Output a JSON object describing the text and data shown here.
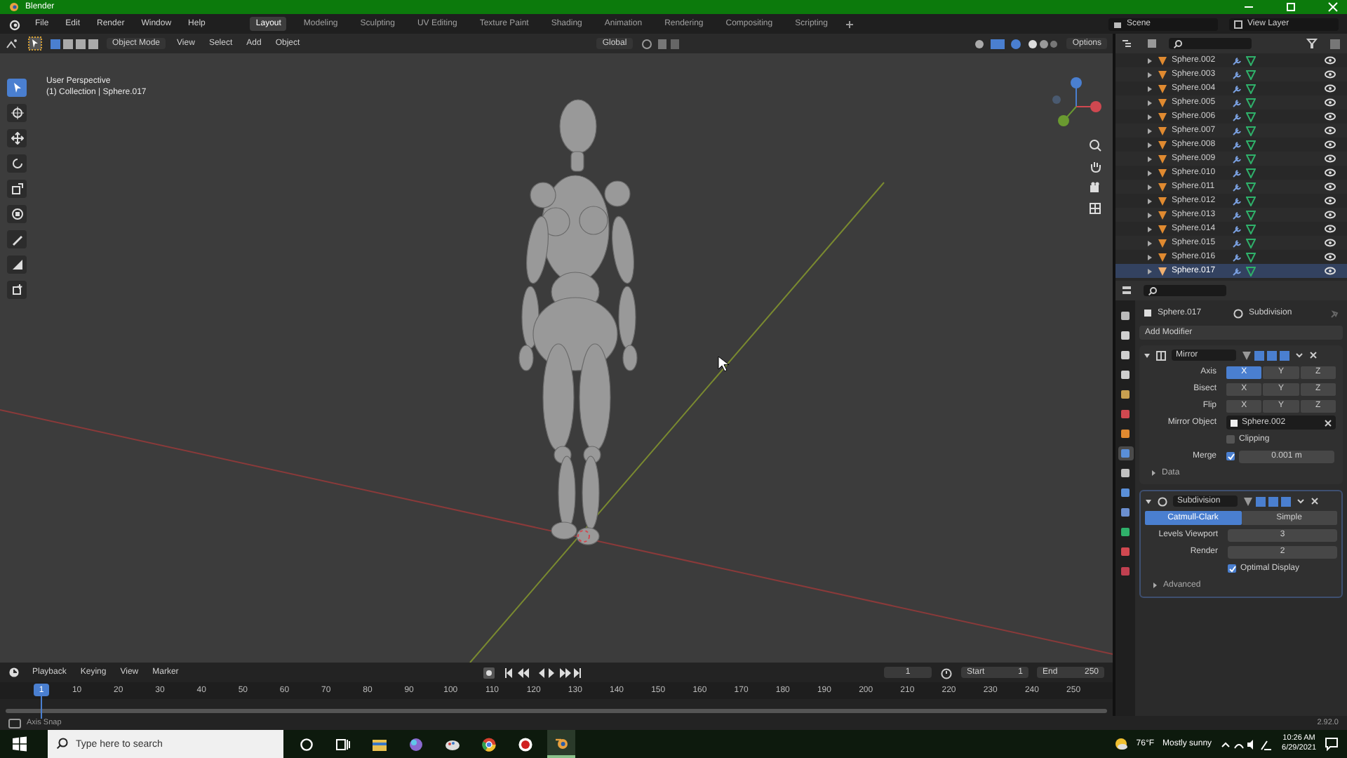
{
  "window": {
    "title": "Blender"
  },
  "menu": [
    "File",
    "Edit",
    "Render",
    "Window",
    "Help"
  ],
  "workspaces": [
    {
      "label": "Layout",
      "selected": true
    },
    {
      "label": "Modeling",
      "selected": false
    },
    {
      "label": "Sculpting",
      "selected": false
    },
    {
      "label": "UV Editing",
      "selected": false
    },
    {
      "label": "Texture Paint",
      "selected": false
    },
    {
      "label": "Shading",
      "selected": false
    },
    {
      "label": "Animation",
      "selected": false
    },
    {
      "label": "Rendering",
      "selected": false
    },
    {
      "label": "Compositing",
      "selected": false
    },
    {
      "label": "Scripting",
      "selected": false
    }
  ],
  "scene": "Scene",
  "view_layer": "View Layer",
  "viewport": {
    "mode": "Object Mode",
    "menus": [
      "View",
      "Select",
      "Add",
      "Object"
    ],
    "orientation": "Global",
    "options": "Options",
    "overlay_title": "User Perspective",
    "overlay_info": "(1) Collection | Sphere.017",
    "tools": [
      {
        "kind": "select",
        "selected": true
      },
      {
        "kind": "cursor",
        "selected": false
      },
      {
        "kind": "move",
        "selected": false
      },
      {
        "kind": "rotate",
        "selected": false
      },
      {
        "kind": "scale",
        "selected": false
      },
      {
        "kind": "transform",
        "selected": false
      },
      {
        "kind": "annotate",
        "selected": false
      },
      {
        "kind": "measure",
        "selected": false
      },
      {
        "kind": "add-cube",
        "selected": false
      }
    ]
  },
  "outliner": {
    "items": [
      {
        "name": "Sphere.002",
        "selected": false
      },
      {
        "name": "Sphere.003",
        "selected": false
      },
      {
        "name": "Sphere.004",
        "selected": false
      },
      {
        "name": "Sphere.005",
        "selected": false
      },
      {
        "name": "Sphere.006",
        "selected": false
      },
      {
        "name": "Sphere.007",
        "selected": false
      },
      {
        "name": "Sphere.008",
        "selected": false
      },
      {
        "name": "Sphere.009",
        "selected": false
      },
      {
        "name": "Sphere.010",
        "selected": false
      },
      {
        "name": "Sphere.011",
        "selected": false
      },
      {
        "name": "Sphere.012",
        "selected": false
      },
      {
        "name": "Sphere.013",
        "selected": false
      },
      {
        "name": "Sphere.014",
        "selected": false
      },
      {
        "name": "Sphere.015",
        "selected": false
      },
      {
        "name": "Sphere.016",
        "selected": false
      },
      {
        "name": "Sphere.017",
        "selected": true
      }
    ]
  },
  "properties": {
    "tabs": [
      {
        "selected": false
      },
      {
        "selected": false
      },
      {
        "selected": false
      },
      {
        "selected": false
      },
      {
        "selected": false
      },
      {
        "selected": false
      },
      {
        "selected": false
      },
      {
        "selected": true
      },
      {
        "selected": false
      },
      {
        "selected": false
      },
      {
        "selected": false
      },
      {
        "selected": false
      },
      {
        "selected": false
      },
      {
        "selected": false
      }
    ],
    "object": "Sphere.017",
    "modifier": "Subdivision",
    "add_modifier": "Add Modifier",
    "modifiers": [
      {
        "kind": "mirror",
        "name": "Mirror",
        "axis_rows": [
          {
            "label": "Axis",
            "buttons": [
              {
                "label": "X",
                "selected": true
              },
              {
                "label": "Y",
                "selected": false
              },
              {
                "label": "Z",
                "selected": false
              }
            ]
          },
          {
            "label": "Bisect",
            "buttons": [
              {
                "label": "X",
                "selected": false
              },
              {
                "label": "Y",
                "selected": false
              },
              {
                "label": "Z",
                "selected": false
              }
            ]
          },
          {
            "label": "Flip",
            "buttons": [
              {
                "label": "X",
                "selected": false
              },
              {
                "label": "Y",
                "selected": false
              },
              {
                "label": "Z",
                "selected": false
              }
            ]
          }
        ],
        "mirror_object_label": "Mirror Object",
        "mirror_object": "Sphere.002",
        "clipping": {
          "label": "Clipping",
          "checked": false
        },
        "merge": {
          "label": "Merge",
          "checked": true,
          "value": "0.001 m"
        },
        "subpanel": {
          "label": "Data",
          "expanded": false
        }
      },
      {
        "kind": "subdivision",
        "name": "Subdivision",
        "types": [
          {
            "label": "Catmull-Clark",
            "selected": true
          },
          {
            "label": "Simple",
            "selected": false
          }
        ],
        "fields": [
          {
            "label": "Levels Viewport",
            "value": "3"
          },
          {
            "label": "Render",
            "value": "2"
          }
        ],
        "optimal_display": {
          "label": "Optimal Display",
          "checked": true
        },
        "subpanel": {
          "label": "Advanced",
          "expanded": false
        }
      }
    ]
  },
  "timeline": {
    "menus": [
      "Playback",
      "Keying",
      "View",
      "Marker"
    ],
    "current_frame": "1",
    "start_label": "Start",
    "start": "1",
    "end_label": "End",
    "end": "250",
    "marker": "1",
    "ticks": [
      "10",
      "20",
      "30",
      "40",
      "50",
      "60",
      "70",
      "80",
      "90",
      "100",
      "110",
      "120",
      "130",
      "140",
      "150",
      "160",
      "170",
      "180",
      "190",
      "200",
      "210",
      "220",
      "230",
      "240",
      "250"
    ]
  },
  "status_bar": {
    "hint": "Axis Snap",
    "version": "2.92.0"
  },
  "taskbar": {
    "search_placeholder": "Type here to search",
    "apps": [
      {
        "kind": "cortana",
        "selected": false
      },
      {
        "kind": "task-view",
        "selected": false
      },
      {
        "kind": "folder",
        "selected": false
      },
      {
        "kind": "ball",
        "selected": false
      },
      {
        "kind": "paint",
        "selected": false
      },
      {
        "kind": "chrome",
        "selected": false
      },
      {
        "kind": "record",
        "selected": false
      },
      {
        "kind": "blender",
        "selected": true
      }
    ],
    "temperature": "76°F",
    "weather": "Mostly sunny",
    "time": "10:26 AM",
    "date": "6/29/2021"
  }
}
